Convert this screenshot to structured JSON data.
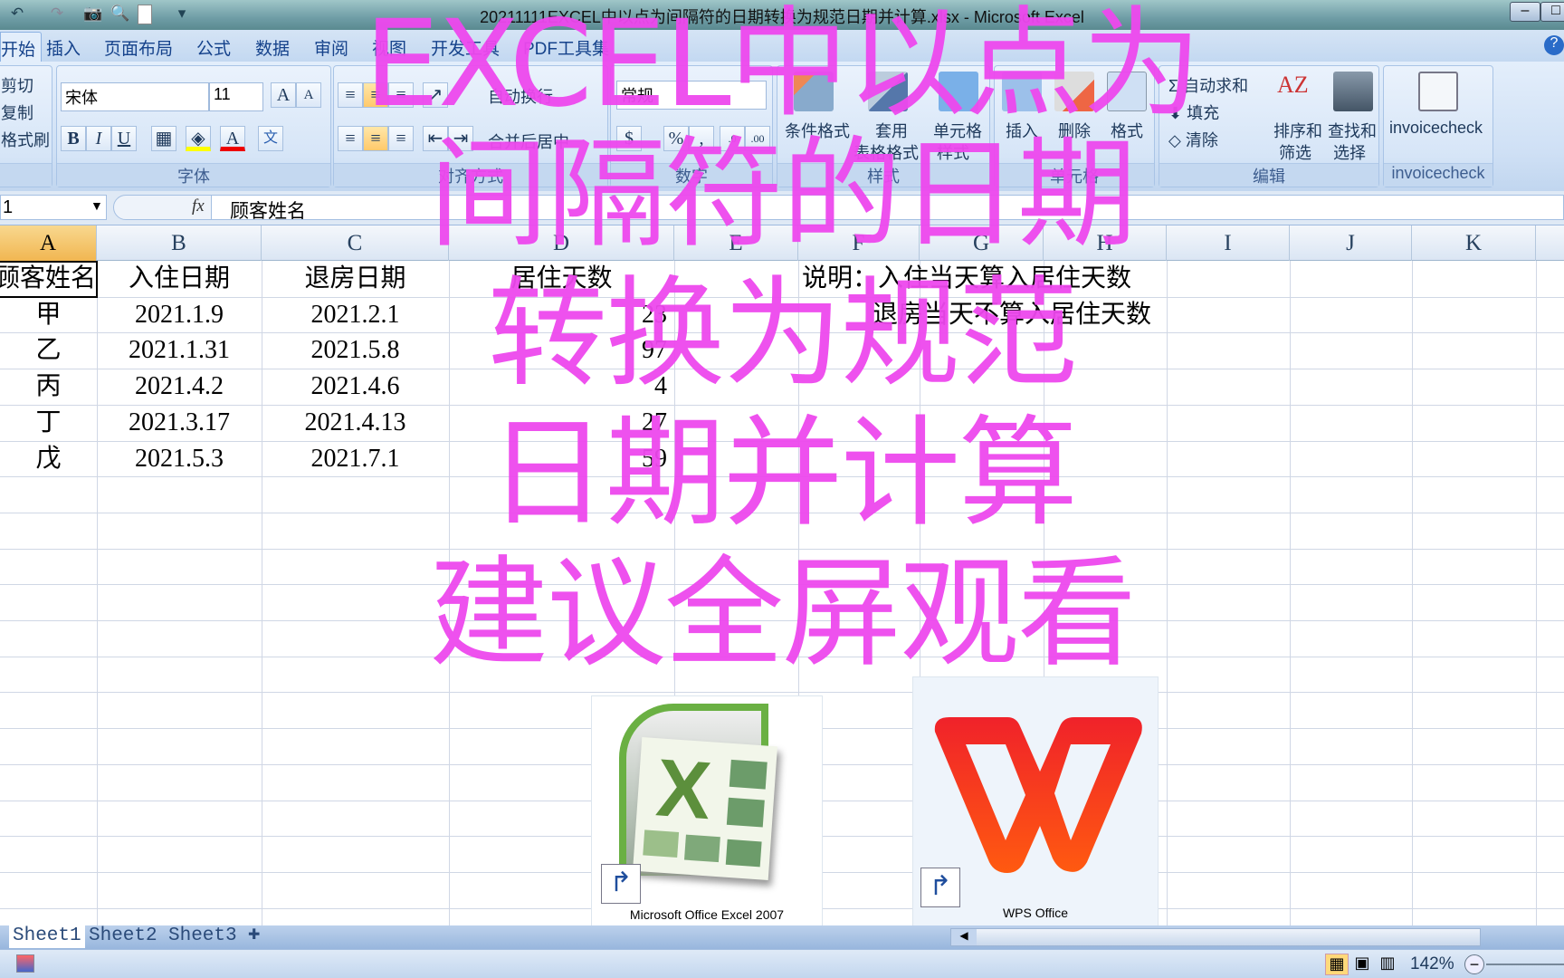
{
  "window": {
    "title": "20211111EXCEL中以点为间隔符的日期转换为规范日期并计算.xlsx - Microsoft Excel"
  },
  "tabs": [
    "开始",
    "插入",
    "页面布局",
    "公式",
    "数据",
    "审阅",
    "视图",
    "开发工具",
    "PDF工具集"
  ],
  "ribbon": {
    "clipboard": {
      "cut": "剪切",
      "copy": "复制",
      "format_painter": "格式刷"
    },
    "font": {
      "name": "宋体",
      "size": "11",
      "bold": "B",
      "italic": "I",
      "underline": "U",
      "label": "字体"
    },
    "alignment": {
      "wrap": "自动换行",
      "merge": "合并后居中",
      "label": "对齐方式"
    },
    "number": {
      "format": "常规",
      "percent": "%",
      "comma": ",",
      "label": "数字"
    },
    "styles": {
      "conditional": "条件格式",
      "table1": "套用",
      "table2": "表格格式",
      "cell1": "单元格",
      "cell2": "样式",
      "label": "样式"
    },
    "cells": {
      "insert": "插入",
      "delete": "删除",
      "format": "格式",
      "label": "单元格"
    },
    "editing": {
      "autosum": "自动求和",
      "fill": "填充",
      "clear": "清除",
      "sort1": "排序和",
      "sort2": "筛选",
      "find1": "查找和",
      "find2": "选择",
      "label": "编辑"
    },
    "invoice": {
      "button": "invoicecheck",
      "label": "invoicecheck"
    }
  },
  "formula_bar": {
    "name_box": "1",
    "fx": "fx",
    "content": "顾客姓名"
  },
  "columns": [
    "A",
    "B",
    "C",
    "D",
    "E",
    "F",
    "G",
    "H",
    "I",
    "J",
    "K"
  ],
  "sheet": {
    "headers": [
      "顾客姓名",
      "入住日期",
      "退房日期",
      "居住天数"
    ],
    "rows": [
      [
        "甲",
        "2021.1.9",
        "2021.2.1",
        "23"
      ],
      [
        "乙",
        "2021.1.31",
        "2021.5.8",
        "97"
      ],
      [
        "丙",
        "2021.4.2",
        "2021.4.6",
        "4"
      ],
      [
        "丁",
        "2021.3.17",
        "2021.4.13",
        "27"
      ],
      [
        "戊",
        "2021.5.3",
        "2021.7.1",
        "59"
      ]
    ],
    "note1": "说明：入住当天算入居住天数",
    "note2": "退房当天不算入居住天数"
  },
  "overlay": {
    "lines": [
      "EXCEL中以点为",
      "间隔符的日期",
      "转换为规范",
      "日期并计算",
      "建议全屏观看"
    ],
    "color": "#ee48ee"
  },
  "desktop_icons": [
    {
      "label": "Microsoft Office Excel 2007",
      "icon": "excel-2007-icon"
    },
    {
      "label": "WPS Office",
      "icon": "wps-office-icon"
    }
  ],
  "sheet_tabs": [
    "Sheet1",
    "Sheet2",
    "Sheet3"
  ],
  "status": {
    "zoom": "142%"
  }
}
